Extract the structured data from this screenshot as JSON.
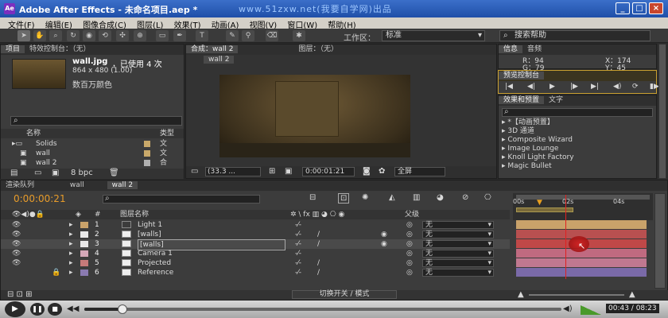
{
  "window": {
    "title": "Adobe After Effects - 未命名项目.aep *",
    "watermark": "www.51zxw.net(我要自学网)出品"
  },
  "menu": [
    "文件(F)",
    "编辑(E)",
    "图像合成(C)",
    "图层(L)",
    "效果(T)",
    "动画(A)",
    "视图(V)",
    "窗口(W)",
    "帮助(H)"
  ],
  "toolbar": {
    "workspace_label": "工作区：",
    "workspace_value": "标准",
    "search_placeholder": "搜索帮助"
  },
  "project": {
    "tabs": [
      "项目",
      "特效控制台：（无）"
    ],
    "file_name": "wall.jpg",
    "used": "，已使用 4 次",
    "dims": "864 x 480 (1.00)",
    "colors": "数百万颜色",
    "col_name": "名称",
    "col_type": "类型",
    "items": [
      {
        "name": "Solids",
        "type": "文"
      },
      {
        "name": "wall",
        "type": "文"
      },
      {
        "name": "wall 2",
        "type": "合"
      }
    ],
    "bpc": "8 bpc"
  },
  "comp": {
    "tab": "合成：wall 2",
    "layer_tab": "图层：（无）",
    "sub_tab": "wall 2",
    "zoom": "(33.3 ...",
    "timecode": "0:00:01:21",
    "view": "全屏"
  },
  "info": {
    "tabs": [
      "信息",
      "音频"
    ],
    "r": "R：94",
    "g": "G：79",
    "x": "X：174",
    "y": "Y：45"
  },
  "preview": {
    "title": "预览控制台"
  },
  "effects": {
    "tabs": [
      "效果和预置",
      "文字"
    ],
    "items": [
      "*【动画预置】",
      "3D 通道",
      "Composite Wizard",
      "Image Lounge",
      "Knoll Light Factory",
      "Magic Bullet"
    ]
  },
  "timeline": {
    "tabs": [
      "渲染队列",
      "wall",
      "wall 2"
    ],
    "timecode": "0:00:00:21",
    "col_layer": "图层名称",
    "col_parent": "父级",
    "ticks": [
      "00s",
      "02s",
      "04s"
    ],
    "footer": "切换开关 / 模式",
    "layers": [
      {
        "num": "1",
        "name": "Light 1",
        "color": "#c9a26a",
        "parent": "无"
      },
      {
        "num": "2",
        "name": "[walls]",
        "color": "#e8e8e8",
        "parent": "无"
      },
      {
        "num": "3",
        "name": "[walls]",
        "color": "#e8e8e8",
        "parent": "无"
      },
      {
        "num": "4",
        "name": "Camera 1",
        "color": "#d4a8b8",
        "parent": "无"
      },
      {
        "num": "5",
        "name": "Projected",
        "color": "#c77a7a",
        "parent": "无"
      },
      {
        "num": "6",
        "name": "Reference",
        "color": "#8a7ab0",
        "parent": "无"
      }
    ]
  },
  "player": {
    "time": "00:43 / 08:23",
    "progress": 0.08
  }
}
